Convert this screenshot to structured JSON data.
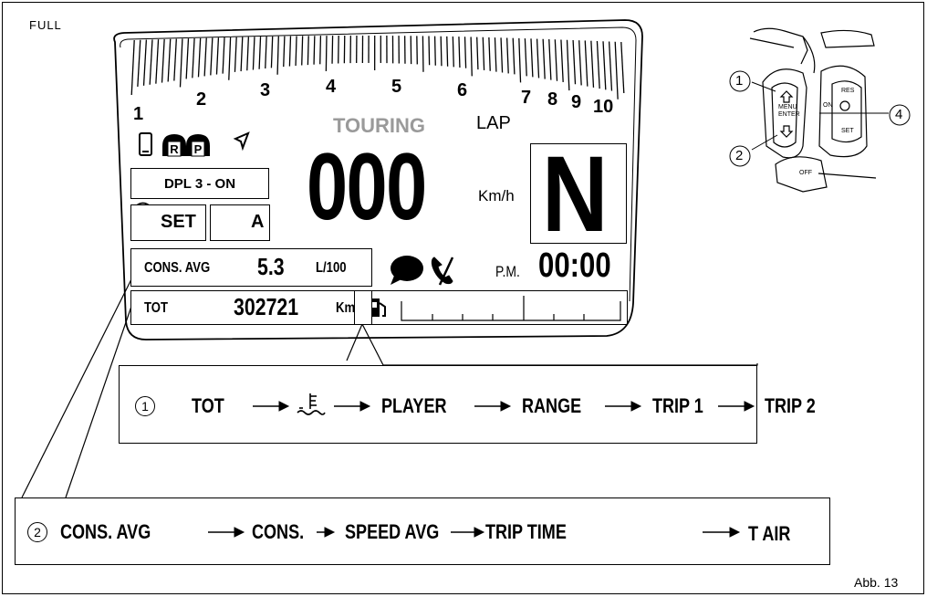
{
  "corner_label": "FULL",
  "figure_label": "Abb. 13",
  "dashboard": {
    "rpm_ticks": [
      "1",
      "2",
      "3",
      "4",
      "5",
      "6",
      "7",
      "8",
      "9",
      "10"
    ],
    "mode": "TOURING",
    "lap": "LAP",
    "dpl": "DPL 3 - ON",
    "set_label": "SET",
    "light_mode": "A",
    "speed": "000",
    "speed_unit": "Km/h",
    "gear": "N",
    "cons_label": "CONS. AVG",
    "cons_value": "5.3",
    "cons_unit": "L/100",
    "tot_label": "TOT",
    "tot_value": "302721",
    "tot_unit": "Km",
    "ampm": "P.M.",
    "clock": "00:00",
    "icons": [
      "phone-icon",
      "rider-R-icon",
      "passenger-P-icon",
      "navigation-arrow-icon",
      "set-gauge-icon",
      "headlight-icon",
      "message-bubble-icon",
      "phone-call-icon",
      "fuel-pump-icon"
    ]
  },
  "switch_callouts": [
    "1",
    "2",
    "4"
  ],
  "switch": {
    "menu": "MENU",
    "enter": "ENTER",
    "res": "RES",
    "set": "SET",
    "on": "ON",
    "off": "OFF"
  },
  "sequence1": {
    "number": "1",
    "items": [
      "TOT",
      "coolant-temp-icon",
      "PLAYER",
      "RANGE",
      "TRIP 1",
      "TRIP 2"
    ]
  },
  "sequence2": {
    "number": "2",
    "items": [
      "CONS. AVG",
      "CONS.",
      "SPEED AVG",
      "TRIP TIME",
      "T AIR"
    ]
  }
}
